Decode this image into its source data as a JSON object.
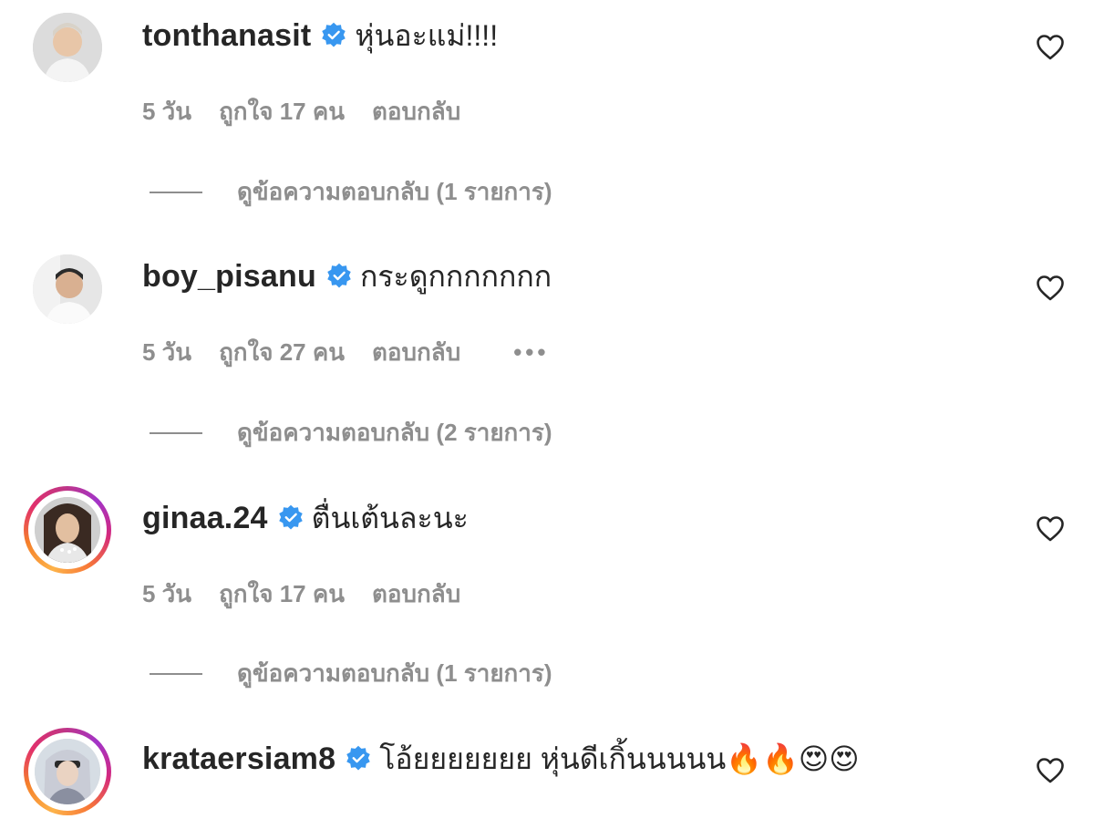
{
  "comments": [
    {
      "username": "tonthanasit",
      "text": "หุ่นอะแม่!!!!",
      "time": "5 วัน",
      "likes": "ถูกใจ 17 คน",
      "reply": "ตอบกลับ",
      "view_replies": "ดูข้อความตอบกลับ (1 รายการ)",
      "verified": true
    },
    {
      "username": "boy_pisanu",
      "text": "กระดูกกกกกกก",
      "time": "5 วัน",
      "likes": "ถูกใจ 27 คน",
      "reply": "ตอบกลับ",
      "more": "•••",
      "view_replies": "ดูข้อความตอบกลับ (2 รายการ)",
      "verified": true
    },
    {
      "username": "ginaa.24",
      "text": "ตื่นเต้นละนะ",
      "time": "5 วัน",
      "likes": "ถูกใจ 17 คน",
      "reply": "ตอบกลับ",
      "view_replies": "ดูข้อความตอบกลับ (1 รายการ)",
      "verified": true
    },
    {
      "username": "krataersiam8",
      "text": "โอ้ยยยยยยย หุ่นดีเกิ้นนนนน🔥🔥😍😍",
      "verified": true
    }
  ],
  "colors": {
    "primary_text": "#262626",
    "secondary_text": "#8e8e8e",
    "verified_blue": "#3897f0"
  },
  "icons": {
    "verified": "verified-badge-icon",
    "like": "heart-outline-icon",
    "more": "more-options-icon"
  }
}
